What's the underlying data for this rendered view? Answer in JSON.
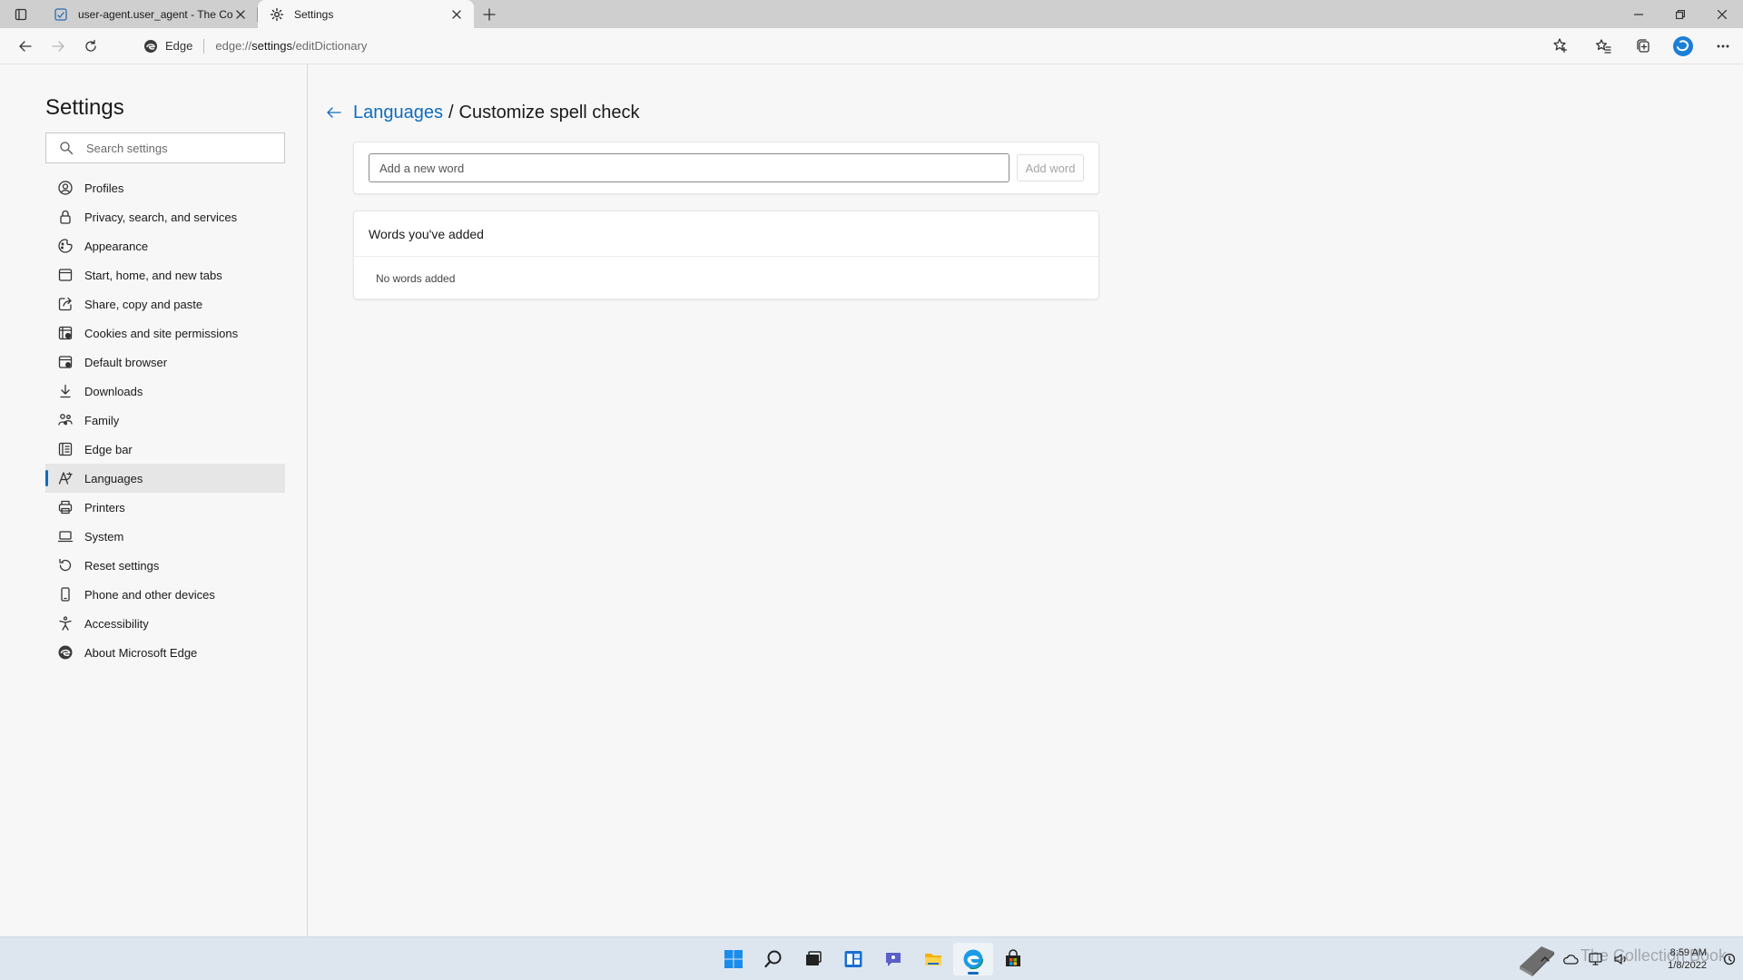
{
  "window": {
    "tabs": [
      {
        "title": "user-agent.user_agent - The Coll",
        "icon": "document-icon",
        "active": false
      },
      {
        "title": "Settings",
        "icon": "gear-icon",
        "active": true
      }
    ],
    "controls": [
      "minimize-icon",
      "restore-icon",
      "close-icon"
    ]
  },
  "toolbar": {
    "brand": "Edge",
    "url_scheme": "edge://",
    "url_host": "settings",
    "url_path": "/editDictionary"
  },
  "sidebar": {
    "title": "Settings",
    "search_placeholder": "Search settings",
    "items": [
      {
        "label": "Profiles",
        "icon": "profile-icon"
      },
      {
        "label": "Privacy, search, and services",
        "icon": "lock-icon"
      },
      {
        "label": "Appearance",
        "icon": "appearance-icon"
      },
      {
        "label": "Start, home, and new tabs",
        "icon": "home-tabs-icon"
      },
      {
        "label": "Share, copy and paste",
        "icon": "share-icon"
      },
      {
        "label": "Cookies and site permissions",
        "icon": "cookies-icon"
      },
      {
        "label": "Default browser",
        "icon": "browser-icon"
      },
      {
        "label": "Downloads",
        "icon": "download-icon"
      },
      {
        "label": "Family",
        "icon": "family-icon"
      },
      {
        "label": "Edge bar",
        "icon": "edge-bar-icon"
      },
      {
        "label": "Languages",
        "icon": "languages-icon",
        "selected": true
      },
      {
        "label": "Printers",
        "icon": "printer-icon"
      },
      {
        "label": "System",
        "icon": "system-icon"
      },
      {
        "label": "Reset settings",
        "icon": "reset-icon"
      },
      {
        "label": "Phone and other devices",
        "icon": "phone-icon"
      },
      {
        "label": "Accessibility",
        "icon": "accessibility-icon"
      },
      {
        "label": "About Microsoft Edge",
        "icon": "edge-logo-icon"
      }
    ]
  },
  "main": {
    "breadcrumb_parent": "Languages",
    "breadcrumb_separator": "/",
    "breadcrumb_current": "Customize spell check",
    "new_word_placeholder": "Add a new word",
    "add_word_label": "Add word",
    "words_header": "Words you've added",
    "words_empty": "No words added"
  },
  "taskbar": {
    "time": "8:59 AM",
    "date": "1/8/2022",
    "watermark": "The Collection Book",
    "apps": [
      "start-icon",
      "search-icon",
      "task-view-icon",
      "widgets-icon",
      "chat-icon",
      "file-explorer-icon",
      "edge-icon",
      "store-icon"
    ]
  },
  "colors": {
    "accent": "#0f6cbd",
    "tabstrip": "#cfcfcf",
    "background": "#f7f7f7",
    "taskbar": "#dde6ef"
  }
}
